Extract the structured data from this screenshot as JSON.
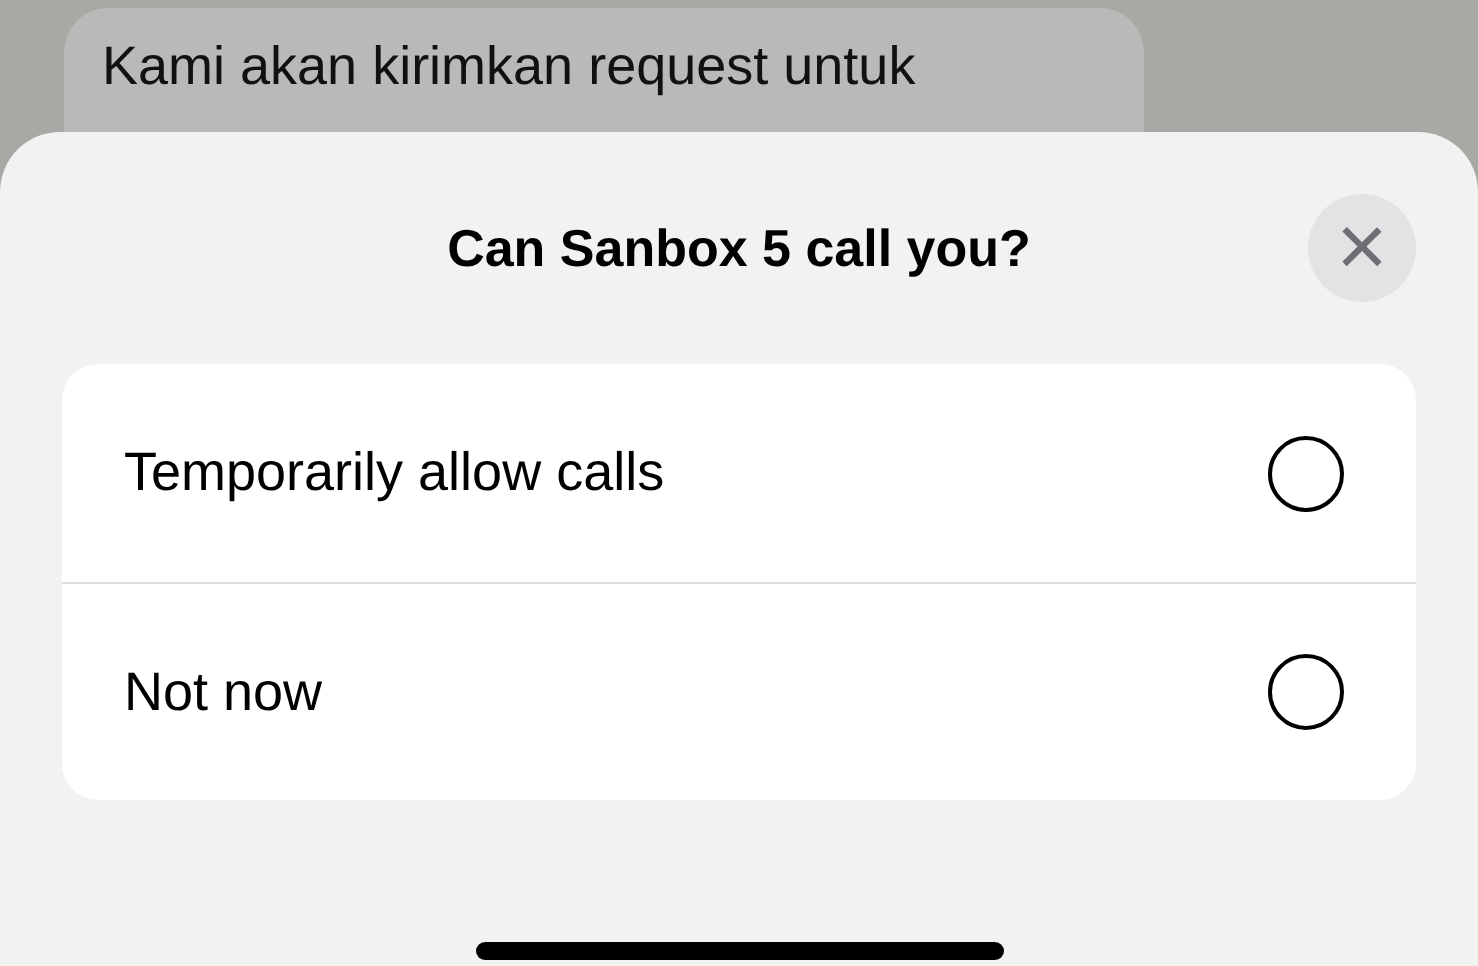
{
  "chat": {
    "message": "Kami akan kirimkan request untuk"
  },
  "sheet": {
    "title": "Can Sanbox 5 call you?",
    "close": "×",
    "options": [
      {
        "label": "Temporarily allow calls",
        "selected": false
      },
      {
        "label": "Not now",
        "selected": false
      }
    ]
  }
}
